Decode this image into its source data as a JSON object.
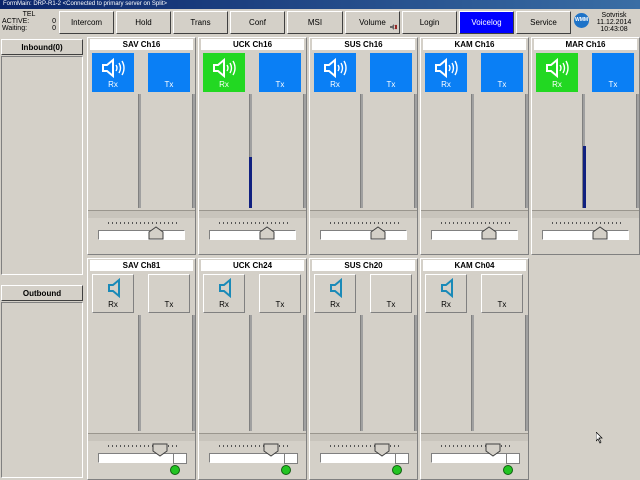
{
  "window": {
    "title": "FormMain: DRP-R1-2   <Connected to primary server on Split>"
  },
  "info": {
    "tel_label": "TEL",
    "active_label": "ACTIVE:",
    "active_value": "0",
    "waiting_label": "Waiting:",
    "waiting_value": "0"
  },
  "toolbar": {
    "buttons": [
      "Intercom",
      "Hold",
      "Trans",
      "Conf",
      "MSI",
      "Volume",
      "Login",
      "Voicelog",
      "Service"
    ]
  },
  "clock": {
    "logo": "WMM",
    "user": "Sotvrisk",
    "date": "11.12.2014",
    "time": "10:43:08"
  },
  "left": {
    "inbound": "Inbound(0)",
    "outbound": "Outbound"
  },
  "rx_label": "Rx",
  "tx_label": "Tx",
  "colors": {
    "active_blue": "#0a7ff5",
    "rx_green": "#22d822",
    "voicelog_blue": "#0000ff"
  },
  "channels_top": [
    {
      "name": "SAV Ch16",
      "rx_state": "blue",
      "level": 0
    },
    {
      "name": "UCK Ch16",
      "rx_state": "green",
      "level": 0.5
    },
    {
      "name": "SUS Ch16",
      "rx_state": "blue",
      "level": 0
    },
    {
      "name": "KAM Ch16",
      "rx_state": "blue",
      "level": 0
    },
    {
      "name": "MAR Ch16",
      "rx_state": "green",
      "level": 0.6
    }
  ],
  "channels_bottom": [
    {
      "name": "SAV Ch81"
    },
    {
      "name": "UCK Ch24"
    },
    {
      "name": "SUS Ch20"
    },
    {
      "name": "KAM Ch04"
    }
  ]
}
